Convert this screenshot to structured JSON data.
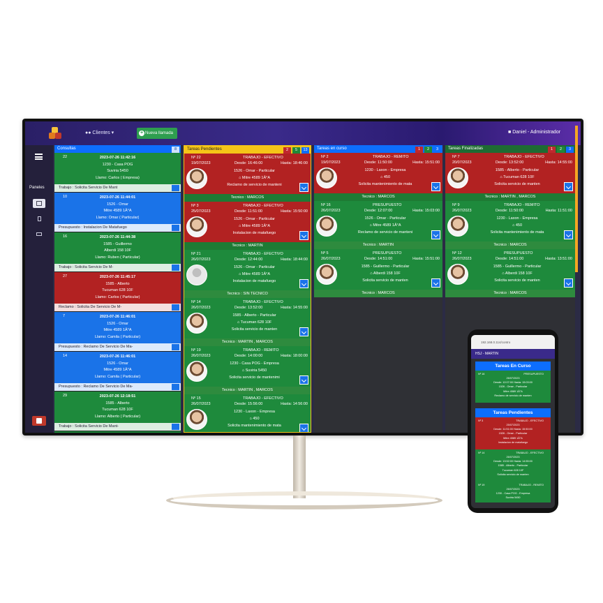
{
  "navbar": {
    "clientes_label": "Clientes",
    "nueva_llamada_label": "Nueva llamada",
    "user_label": "Daniel - Administrador"
  },
  "sidebar": {
    "paneles_label": "Paneles"
  },
  "consultas": {
    "title": "Consultas",
    "count": "8",
    "items": [
      {
        "num": "22",
        "color": "green",
        "datetime": "2023-07-26 11:42:16",
        "client": "1230 - Casa POG",
        "address": "Suviria 5450",
        "caller": "Llamo: Carlos ( Empresa)",
        "footer": "Trabajo : Solicita Servicio De Mant"
      },
      {
        "num": "10",
        "color": "blue",
        "datetime": "2023-07-26 11:44:01",
        "client": "1526 - Omar",
        "address": "Mitre 4589 1Â°A",
        "caller": "Llamo: Omar ( Particular)",
        "footer": "Presupuesto : Instalacion De Matafuego"
      },
      {
        "num": "16",
        "color": "green",
        "datetime": "2023-07-26 11:44:38",
        "client": "1585 - Guillermo",
        "address": "Alberdi 158 10F",
        "caller": "Llamo: Ruben ( Particular)",
        "footer": "Trabajo : Solicita Servicio De M-"
      },
      {
        "num": "27",
        "color": "red",
        "datetime": "2023-07-26 11:45:17",
        "client": "1585 - Alberto",
        "address": "Tucuman 628 10F",
        "caller": "Llamo: Carlos ( Particular)",
        "footer": "Reclamo : Solicita De Servicio De M-"
      },
      {
        "num": "7",
        "color": "blue",
        "datetime": "2023-07-26 11:46:01",
        "client": "1526 - Omar",
        "address": "Mitre 4589 1Â°A",
        "caller": "Llamo: Camila ( Particular)",
        "footer": "Presupuesto : Reclamo De Servicio De Ma-"
      },
      {
        "num": "14",
        "color": "blue",
        "datetime": "2023-07-26 11:46:01",
        "client": "1526 - Omar",
        "address": "Mitre 4589 1Â°A",
        "caller": "Llamo: Camila ( Particular)",
        "footer": "Presupuesto : Reclamo De Servicio De Ma-"
      },
      {
        "num": "29",
        "color": "green",
        "datetime": "2023-07-26 12:18:51",
        "client": "1585 - Alberto",
        "address": "Tucuman 628 10F",
        "caller": "Llamo: Alberto ( Particular)",
        "footer": "Trabajo : Solicita Servicio De Mant-"
      },
      {
        "num": "30",
        "color": "green",
        "datetime": "2023-07-26 12:45:43",
        "client": "",
        "address": "",
        "caller": "",
        "footer": ""
      }
    ]
  },
  "pendientes": {
    "title": "Tareas Pendientes",
    "badges": [
      "2",
      "5",
      "13"
    ],
    "items": [
      {
        "color": "red",
        "num": "Nº 22",
        "type": "TRABAJO - EFECTIVO",
        "date": "19/07/2023",
        "desde": "Desde: 16:46:00",
        "hasta": "Hasta: 18:46:00",
        "client": "1526 - Omar - Particular",
        "address": "Mitre 4589 1Â°A",
        "desc": "Reclamo de servicio de manteni",
        "tecnico": "Tecnico : MARCOS",
        "photo": true
      },
      {
        "color": "red",
        "num": "Nº 3",
        "type": "TRABAJO - EFECTIVO",
        "date": "25/07/2023",
        "desde": "Desde: 11:51:00",
        "hasta": "Hasta: 15:50:00",
        "client": "1526 - Omar - Particular",
        "address": "Mitre 4589 1Â°A",
        "desc": "Instalacion de matafuego",
        "tecnico": "Tecnico : MARTIN",
        "photo": true
      },
      {
        "color": "green",
        "num": "Nº 21",
        "type": "TRABAJO - EFECTIVO",
        "date": "26/07/2023",
        "desde": "Desde: 12:44:00",
        "hasta": "Hasta: 18:44:00",
        "client": "1526 - Omar - Particular",
        "address": "Mitre 4589 1Â°A",
        "desc": "Instalacion de matafuego",
        "tecnico": "Tecnico : SIN TECNICO",
        "photo": false
      },
      {
        "color": "green",
        "num": "Nº 14",
        "type": "TRABAJO - EFECTIVO",
        "date": "26/07/2023",
        "desde": "Desde: 13:52:00",
        "hasta": "Hasta: 14:55:00",
        "client": "1585 - Alberto - Particular",
        "address": "Tucuman 628 10F",
        "desc": "Solicita servicio de manten",
        "tecnico": "Tecnico : MARTIN , MARCOS",
        "photo": true
      },
      {
        "color": "green",
        "num": "Nº 19",
        "type": "TRABAJO - REMITO",
        "date": "26/07/2023",
        "desde": "Desde: 14:00:00",
        "hasta": "Hasta: 18:00:00",
        "client": "1230 - Casa POG - Empresa",
        "address": "Suviria 5450",
        "desc": "Solicita servicio de mantenimi",
        "tecnico": "Tecnico : MARTIN , MARCOS",
        "photo": true
      },
      {
        "color": "green",
        "num": "Nº 15",
        "type": "TRABAJO - EFECTIVO",
        "date": "26/07/2023",
        "desde": "Desde: 15:56:00",
        "hasta": "Hasta: 14:56:00",
        "client": "1230 - Laxon - Empresa",
        "address": "450",
        "desc": "Solicita mantenimiento de mata",
        "tecnico": "",
        "photo": true
      }
    ]
  },
  "encurso": {
    "title": "Tareas en curso",
    "badges": [
      "1",
      "2",
      "3"
    ],
    "items": [
      {
        "color": "red",
        "num": "Nº 2",
        "type": "TRABAJO - REMITO",
        "date": "19/07/2023",
        "desde": "Desde: 11:50:00",
        "hasta": "Hasta: 15:51:00",
        "client": "1230 - Laxon - Empresa",
        "address": "450",
        "desc": "Solicita mantenimiento de mata",
        "tecnico": "Tecnico : MARCOS",
        "photo": true
      },
      {
        "color": "green",
        "num": "Nº 16",
        "type": "PRESUPUESTO",
        "date": "26/07/2023",
        "desde": "Desde: 12:07:00",
        "hasta": "Hasta: 15:03:00",
        "client": "1526 - Omar - Particular",
        "address": "Mitre 4589 1Â°A",
        "desc": "Reclamo de servicio de manteni",
        "tecnico": "Tecnico : MARTIN",
        "photo": true
      },
      {
        "color": "green",
        "num": "Nº 5",
        "type": "PRESUPUESTO",
        "date": "26/07/2023",
        "desde": "Desde: 14:51:00",
        "hasta": "Hasta: 15:51:00",
        "client": "1585 - Guillermo - Particular",
        "address": "Alberdi 158 10F",
        "desc": "Solicita servicio de manten",
        "tecnico": "Tecnico : MARCOS",
        "photo": true
      }
    ]
  },
  "finalizadas": {
    "title": "Tareas Finalizadas",
    "badges": [
      "1",
      "2",
      "3"
    ],
    "items": [
      {
        "color": "red",
        "num": "Nº 7",
        "type": "TRABAJO - EFECTIVO",
        "date": "20/07/2023",
        "desde": "Desde: 13:52:00",
        "hasta": "Hasta: 14:55:00",
        "client": "1585 - Alberto - Particular",
        "address": "Tucuman 628 10F",
        "desc": "Solicita servicio de manten",
        "tecnico": "Tecnico : MARTIN , MARCOS",
        "photo": true
      },
      {
        "color": "green",
        "num": "Nº 9",
        "type": "TRABAJO - REMITO",
        "date": "26/07/2023",
        "desde": "Desde: 11:50:00",
        "hasta": "Hasta: 11:51:00",
        "client": "1230 - Laxon - Empresa",
        "address": "450",
        "desc": "Solicita mantenimiento de mata",
        "tecnico": "Tecnico : MARCOS",
        "photo": true
      },
      {
        "color": "green",
        "num": "Nº 12",
        "type": "PRESUPUESTO",
        "date": "26/07/2023",
        "desde": "Desde: 14:51:00",
        "hasta": "Hasta: 13:51:00",
        "client": "1585 - Guillermo - Particular",
        "address": "Alberdi 158 10F",
        "desc": "Solicita servicio de manten",
        "tecnico": "Tecnico : MARCOS",
        "photo": true
      }
    ]
  },
  "phone": {
    "url": "192.168.0.114/contro",
    "topbar": "HSJ - MARTIN",
    "section1_title": "Tareas En Curso",
    "section2_title": "Tareas Pendientes",
    "card1": {
      "num": "Nº 16",
      "type": "PRESUPUESTO",
      "date": "26/07/2023",
      "desde": "Desde: 12:07:00",
      "hasta": "Hasta: 15:03:00",
      "client": "1526 - Omar - Particular",
      "address": "Mitre 4589 1Â°A",
      "desc": "Reclamo de servicio de manten"
    },
    "card2": {
      "num": "Nº 3",
      "type": "TRABAJO - EFECTIVO",
      "date": "25/07/2023",
      "desde": "Desde: 11:51:00",
      "hasta": "Hasta: 15:50:00",
      "client": "1526 - Omar - Particular",
      "address": "Mitre 4589 1Â°A",
      "desc": "Instalacion de matafuego"
    },
    "card3": {
      "num": "Nº 14",
      "type": "TRABAJO - EFECTIVO",
      "date": "26/07/2023",
      "desde": "Desde: 13:52:00",
      "hasta": "Hasta: 14:55:00",
      "client": "1585 - Alberto - Particular",
      "address": "Tucuman 628 10F",
      "desc": "Solicita servicio de manten"
    },
    "card4": {
      "num": "Nº 19",
      "type": "TRABAJO - REMITO",
      "date": "26/07/2023",
      "client": "1230 - Casa POG - Empresa",
      "address": "Suviria 5450"
    }
  }
}
